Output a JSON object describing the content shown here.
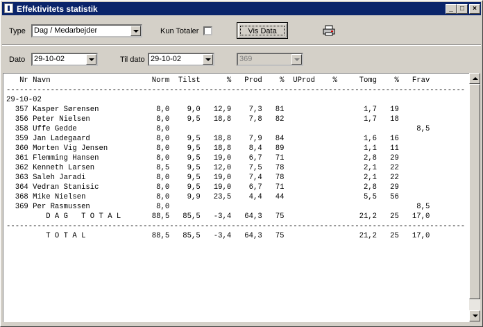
{
  "window": {
    "title": "Effektivitets statistik",
    "controls": {
      "minimize": "_",
      "maximize": "□",
      "close": "×"
    }
  },
  "filters": {
    "type_label": "Type",
    "type_value": "Dag / Medarbejder",
    "kun_totaler_label": "Kun Totaler",
    "vis_data_label": "Vis Data",
    "dato_label": "Dato",
    "dato_value": "29-10-02",
    "til_dato_label": "Til dato",
    "til_dato_value": "29-10-02",
    "third_value": "369"
  },
  "report": {
    "columns": [
      "Nr",
      "Navn",
      "Norm",
      "Tilst",
      "%",
      "Prod",
      "%",
      "UProd",
      "%",
      "Tomg",
      "%",
      "Frav"
    ],
    "date_group": "29-10-02",
    "rows": [
      {
        "nr": "357",
        "navn": "Kasper Sørensen",
        "norm": "8,0",
        "tilst": "9,0",
        "p1": "12,9",
        "prod": "7,3",
        "p2": "81",
        "uprod": "",
        "p3": "",
        "tomg": "1,7",
        "p4": "19",
        "frav": ""
      },
      {
        "nr": "356",
        "navn": "Peter Nielsen",
        "norm": "8,0",
        "tilst": "9,5",
        "p1": "18,8",
        "prod": "7,8",
        "p2": "82",
        "uprod": "",
        "p3": "",
        "tomg": "1,7",
        "p4": "18",
        "frav": ""
      },
      {
        "nr": "358",
        "navn": "Uffe Gedde",
        "norm": "8,0",
        "tilst": "",
        "p1": "",
        "prod": "",
        "p2": "",
        "uprod": "",
        "p3": "",
        "tomg": "",
        "p4": "",
        "frav": "8,5"
      },
      {
        "nr": "359",
        "navn": "Jan Ladegaard",
        "norm": "8,0",
        "tilst": "9,5",
        "p1": "18,8",
        "prod": "7,9",
        "p2": "84",
        "uprod": "",
        "p3": "",
        "tomg": "1,6",
        "p4": "16",
        "frav": ""
      },
      {
        "nr": "360",
        "navn": "Morten Vig Jensen",
        "norm": "8,0",
        "tilst": "9,5",
        "p1": "18,8",
        "prod": "8,4",
        "p2": "89",
        "uprod": "",
        "p3": "",
        "tomg": "1,1",
        "p4": "11",
        "frav": ""
      },
      {
        "nr": "361",
        "navn": "Flemming Hansen",
        "norm": "8,0",
        "tilst": "9,5",
        "p1": "19,0",
        "prod": "6,7",
        "p2": "71",
        "uprod": "",
        "p3": "",
        "tomg": "2,8",
        "p4": "29",
        "frav": ""
      },
      {
        "nr": "362",
        "navn": "Kenneth Larsen",
        "norm": "8,5",
        "tilst": "9,5",
        "p1": "12,0",
        "prod": "7,5",
        "p2": "78",
        "uprod": "",
        "p3": "",
        "tomg": "2,1",
        "p4": "22",
        "frav": ""
      },
      {
        "nr": "363",
        "navn": "Saleh Jaradi",
        "norm": "8,0",
        "tilst": "9,5",
        "p1": "19,0",
        "prod": "7,4",
        "p2": "78",
        "uprod": "",
        "p3": "",
        "tomg": "2,1",
        "p4": "22",
        "frav": ""
      },
      {
        "nr": "364",
        "navn": "Vedran Stanisic",
        "norm": "8,0",
        "tilst": "9,5",
        "p1": "19,0",
        "prod": "6,7",
        "p2": "71",
        "uprod": "",
        "p3": "",
        "tomg": "2,8",
        "p4": "29",
        "frav": ""
      },
      {
        "nr": "368",
        "navn": "Mike Nielsen",
        "norm": "8,0",
        "tilst": "9,9",
        "p1": "23,5",
        "prod": "4,4",
        "p2": "44",
        "uprod": "",
        "p3": "",
        "tomg": "5,5",
        "p4": "56",
        "frav": ""
      },
      {
        "nr": "369",
        "navn": "Per Rasmussen",
        "norm": "8,0",
        "tilst": "",
        "p1": "",
        "prod": "",
        "p2": "",
        "uprod": "",
        "p3": "",
        "tomg": "",
        "p4": "",
        "frav": "8,5"
      }
    ],
    "dag_total": {
      "label": "D A G   T O T A L",
      "norm": "88,5",
      "tilst": "85,5",
      "p1": "-3,4",
      "prod": "64,3",
      "p2": "75",
      "uprod": "",
      "p3": "",
      "tomg": "21,2",
      "p4": "25",
      "frav": "17,0"
    },
    "total": {
      "label": "T O T A L",
      "norm": "88,5",
      "tilst": "85,5",
      "p1": "-3,4",
      "prod": "64,3",
      "p2": "75",
      "uprod": "",
      "p3": "",
      "tomg": "21,2",
      "p4": "25",
      "frav": "17,0"
    }
  },
  "icons": {
    "app": "app-icon",
    "printer": "printer-icon"
  }
}
